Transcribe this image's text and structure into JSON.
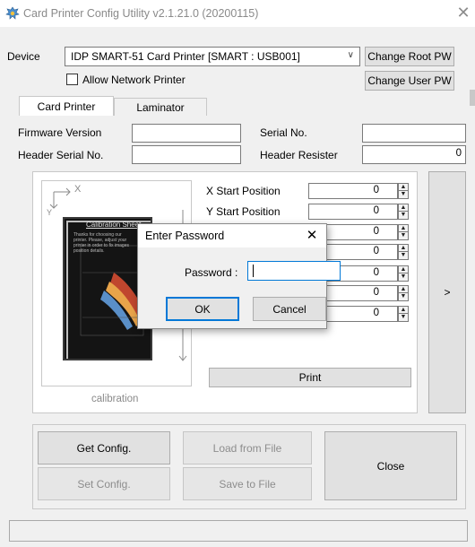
{
  "window": {
    "title": "Card Printer Config Utility v2.1.21.0 (20200115)",
    "icon": "card-printer-icon",
    "close_glyph": "✕"
  },
  "device": {
    "label": "Device",
    "selected": "IDP SMART-51 Card Printer  [SMART : USB001]",
    "allow_network_label": "Allow Network Printer",
    "allow_network_checked": false
  },
  "top_buttons": {
    "change_root": "Change Root PW",
    "change_user": "Change User PW"
  },
  "tabs": [
    {
      "label": "Card Printer",
      "active": true
    },
    {
      "label": "Laminator",
      "active": false
    }
  ],
  "info": {
    "firmware_label": "Firmware Version",
    "firmware_value": "",
    "serial_label": "Serial No.",
    "serial_value": "",
    "header_serial_label": "Header Serial No.",
    "header_serial_value": "",
    "header_resister_label": "Header Resister",
    "header_resister_value": "0"
  },
  "preview": {
    "axis_x": "X",
    "axis_y": "Y",
    "sheet_title": "Calibration Sheet",
    "sheet_text": "Thanks for choosing our printer. Please, adjust your printer in order to fix images position details.",
    "caption": "calibration"
  },
  "positions": [
    {
      "label": "X Start Position",
      "value": "0"
    },
    {
      "label": "Y Start Position",
      "value": "0"
    },
    {
      "label": "",
      "value": "0"
    },
    {
      "label": "",
      "value": "0"
    },
    {
      "label": "",
      "value": "0"
    },
    {
      "label": "",
      "value": "0"
    },
    {
      "label": "",
      "value": "0"
    }
  ],
  "print_button": "Print",
  "next_button": ">",
  "bottom_buttons": {
    "get_config": "Get Config.",
    "set_config": "Set Config.",
    "load_file": "Load from File",
    "save_file": "Save to File",
    "close": "Close"
  },
  "dialog": {
    "title": "Enter Password",
    "close_glyph": "✕",
    "password_label": "Password :",
    "password_value": "",
    "ok": "OK",
    "cancel": "Cancel"
  },
  "colors": {
    "focus_blue": "#0078d7",
    "window_bg": "#f0f0f0"
  }
}
